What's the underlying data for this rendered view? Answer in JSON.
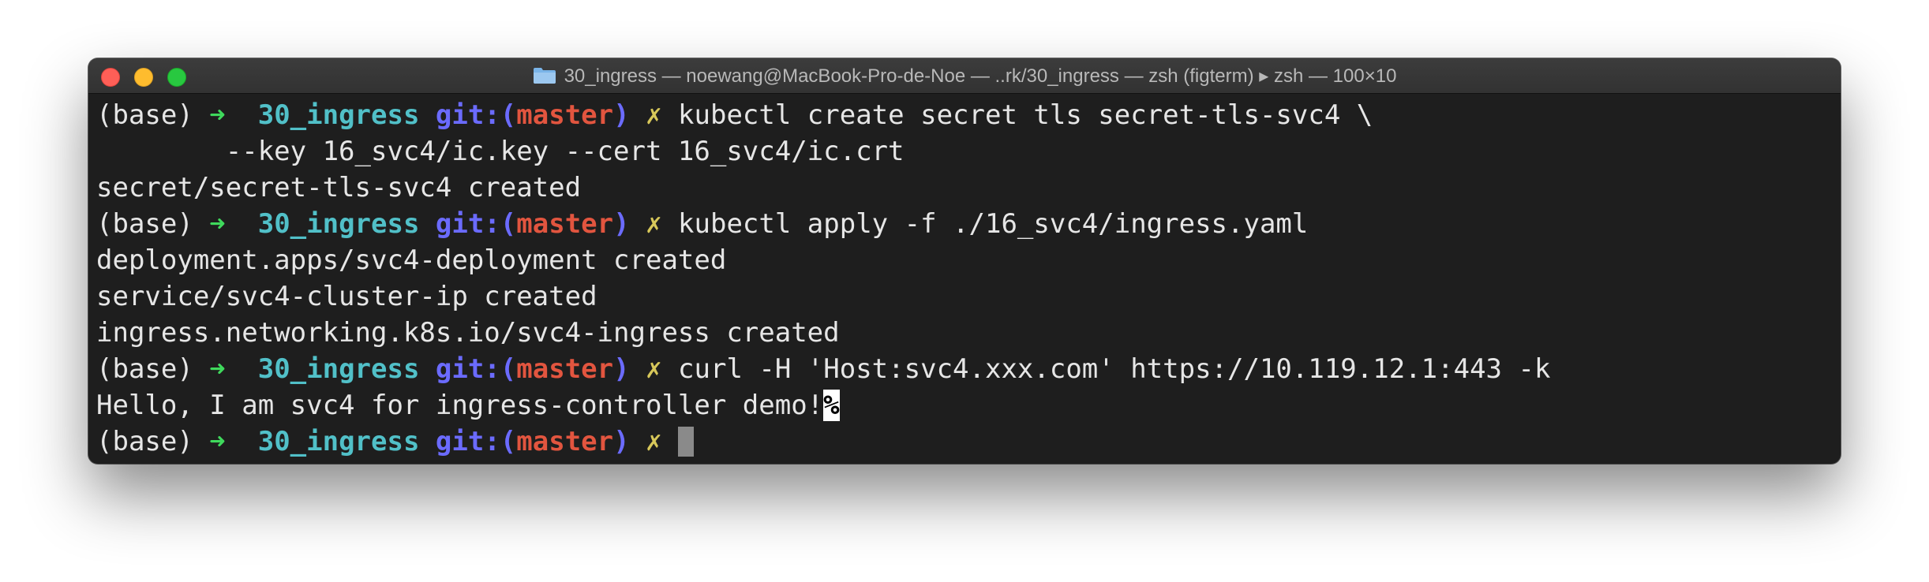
{
  "window": {
    "title": "30_ingress — noewang@MacBook-Pro-de-Noe — ..rk/30_ingress — zsh (figterm) ▸ zsh — 100×10"
  },
  "prompt": {
    "env": "(base) ",
    "arrow": "➜",
    "dir": "30_ingress",
    "git_label": "git:(",
    "branch": "master",
    "git_close": ")",
    "dirty": "✗"
  },
  "lines": [
    {
      "type": "prompt",
      "command": "kubectl create secret tls secret-tls-svc4 \\"
    },
    {
      "type": "output",
      "text": "        --key 16_svc4/ic.key --cert 16_svc4/ic.crt"
    },
    {
      "type": "output",
      "text": "secret/secret-tls-svc4 created"
    },
    {
      "type": "prompt",
      "command": "kubectl apply -f ./16_svc4/ingress.yaml"
    },
    {
      "type": "output",
      "text": "deployment.apps/svc4-deployment created"
    },
    {
      "type": "output",
      "text": "service/svc4-cluster-ip created"
    },
    {
      "type": "output",
      "text": "ingress.networking.k8s.io/svc4-ingress created"
    },
    {
      "type": "prompt",
      "command": "curl -H 'Host:svc4.xxx.com' https://10.119.12.1:443 -k"
    },
    {
      "type": "output",
      "text": "Hello, I am svc4 for ingress-controller demo!",
      "suffix": "%"
    },
    {
      "type": "prompt",
      "command": ""
    }
  ],
  "colors": {
    "background": "#1e1e1e",
    "arrow": "#3fd95c",
    "dir": "#51c0c8",
    "git": "#6b6bff",
    "branch": "#e2553f",
    "dirty": "#d8c85a"
  },
  "icons": [
    "close-light",
    "minimize-light",
    "maximize-light",
    "folder-icon"
  ]
}
